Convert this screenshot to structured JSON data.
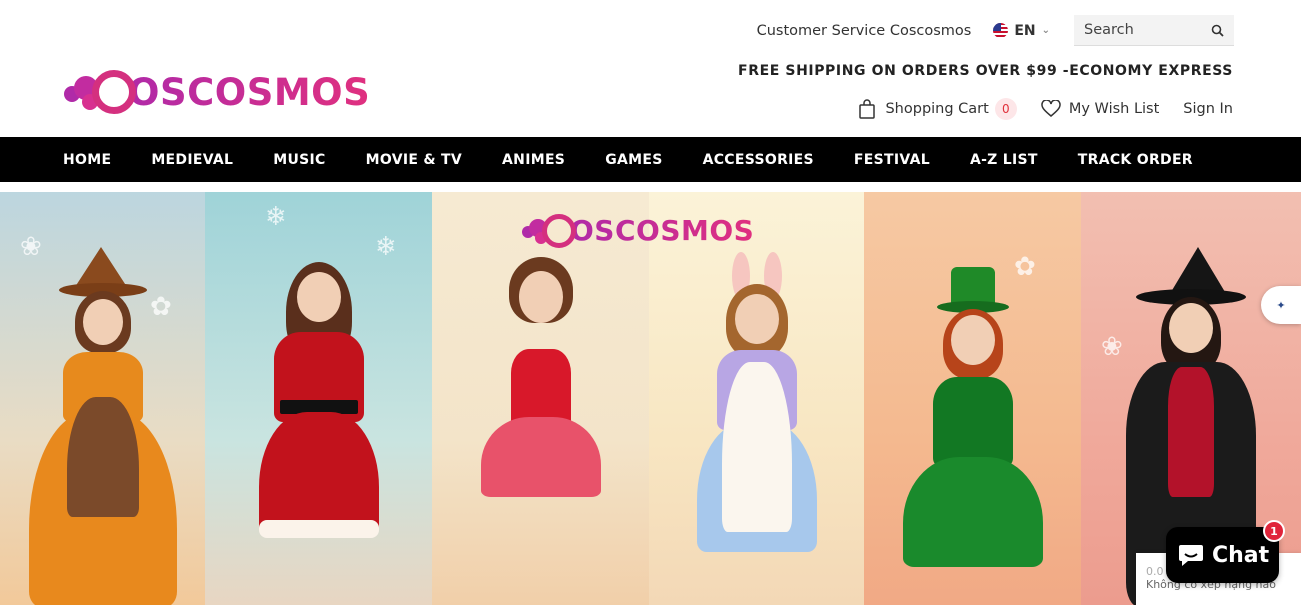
{
  "brand": {
    "name": "OSCOSMOS",
    "colors": {
      "primary": "#b02aa8",
      "secondary": "#e0307f"
    }
  },
  "top": {
    "customer_service": "Customer Service Coscosmos",
    "language": "EN",
    "search_placeholder": "Search"
  },
  "promo": "FREE SHIPPING ON ORDERS OVER $99 -ECONOMY EXPRESS",
  "account": {
    "cart_label": "Shopping Cart",
    "cart_count": "0",
    "wishlist_label": "My Wish List",
    "signin_label": "Sign In"
  },
  "nav": {
    "items": [
      {
        "label": "HOME"
      },
      {
        "label": "MEDIEVAL"
      },
      {
        "label": "MUSIC"
      },
      {
        "label": "MOVIE & TV"
      },
      {
        "label": "ANIMES"
      },
      {
        "label": "GAMES"
      },
      {
        "label": "ACCESSORIES"
      },
      {
        "label": "FESTIVAL"
      },
      {
        "label": "A-Z LIST"
      },
      {
        "label": "TRACK ORDER"
      }
    ]
  },
  "hero": {
    "logo_text": "OSCOSMOS"
  },
  "widgets": {
    "rating_value": "0.0",
    "rating_text": "Không có xếp hạng nào",
    "chat_label": "Chat",
    "chat_badge": "1"
  }
}
